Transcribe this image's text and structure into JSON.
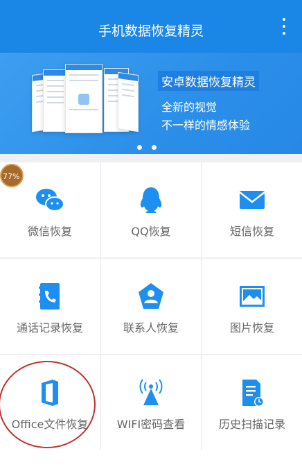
{
  "app": {
    "title": "手机数据恢复精灵"
  },
  "banner": {
    "headline": "安卓数据恢复精灵",
    "subline1": "全新的视觉",
    "subline2": "不一样的情感体验"
  },
  "floating_badge": {
    "text": "77%"
  },
  "grid": {
    "items": [
      {
        "label": "微信恢复",
        "icon": "wechat-icon"
      },
      {
        "label": "QQ恢复",
        "icon": "qq-icon"
      },
      {
        "label": "短信恢复",
        "icon": "sms-icon"
      },
      {
        "label": "通话记录恢复",
        "icon": "call-log-icon"
      },
      {
        "label": "联系人恢复",
        "icon": "contact-icon"
      },
      {
        "label": "图片恢复",
        "icon": "image-icon"
      },
      {
        "label": "Office文件恢复",
        "icon": "office-icon"
      },
      {
        "label": "WIFI密码查看",
        "icon": "wifi-icon"
      },
      {
        "label": "历史扫描记录",
        "icon": "history-icon"
      }
    ]
  },
  "colors": {
    "primary": "#1a86e6",
    "icon_blue": "#1d8ff0",
    "annotation_red": "#c0302b"
  }
}
